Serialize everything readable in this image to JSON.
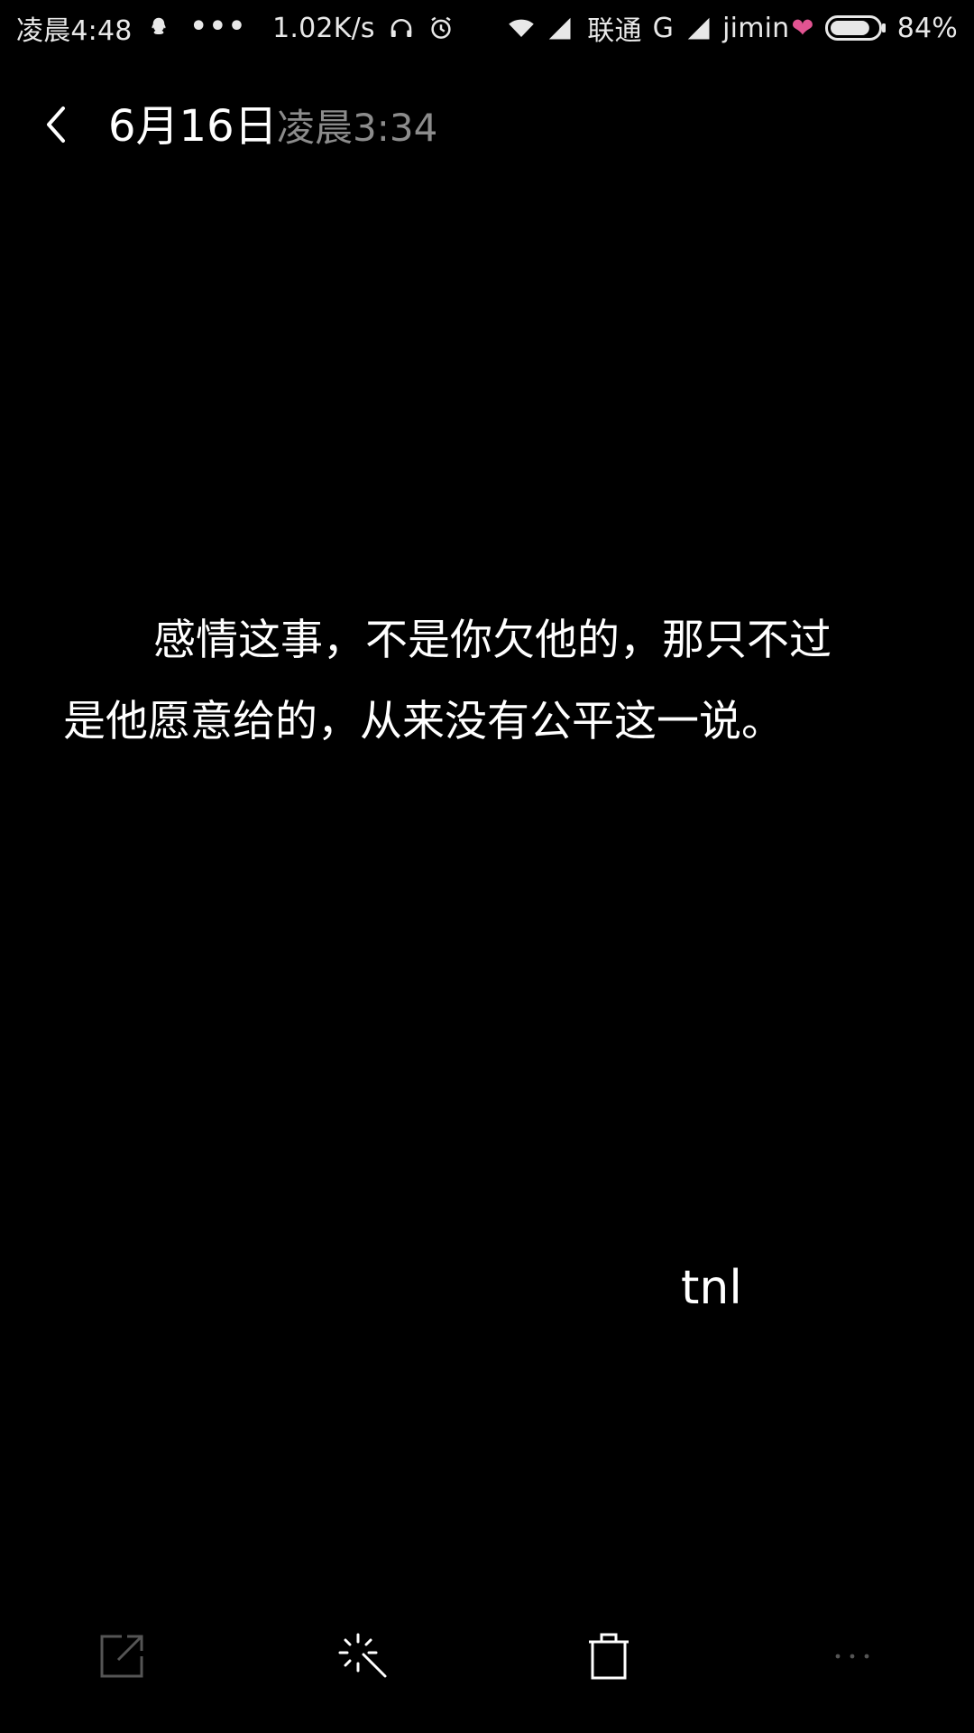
{
  "status_bar": {
    "time": "凌晨4:48",
    "dots": "•••",
    "speed": "1.02K/s",
    "carrier": "联通",
    "network_type": "G",
    "user_name": "jimin",
    "heart": "❤",
    "battery": "84%",
    "battery_level": 0.84,
    "icons": [
      "qq-icon",
      "headphone-icon",
      "alarm-icon",
      "wifi-icon",
      "signal-icon",
      "signal-icon-2",
      "battery-icon"
    ]
  },
  "header": {
    "date": "6月16日",
    "time": "凌晨3:34"
  },
  "note": {
    "line1": "感情这事，不是你欠他的，那只不过",
    "line2": "是他愿意给的，从来没有公平这一说。",
    "signature": "tnl"
  },
  "toolbar": {
    "icons": [
      "share-icon",
      "magic-wand-icon",
      "trash-icon",
      "more-icon"
    ],
    "colors": {
      "active": "#ffffff",
      "dim": "#555555"
    }
  }
}
